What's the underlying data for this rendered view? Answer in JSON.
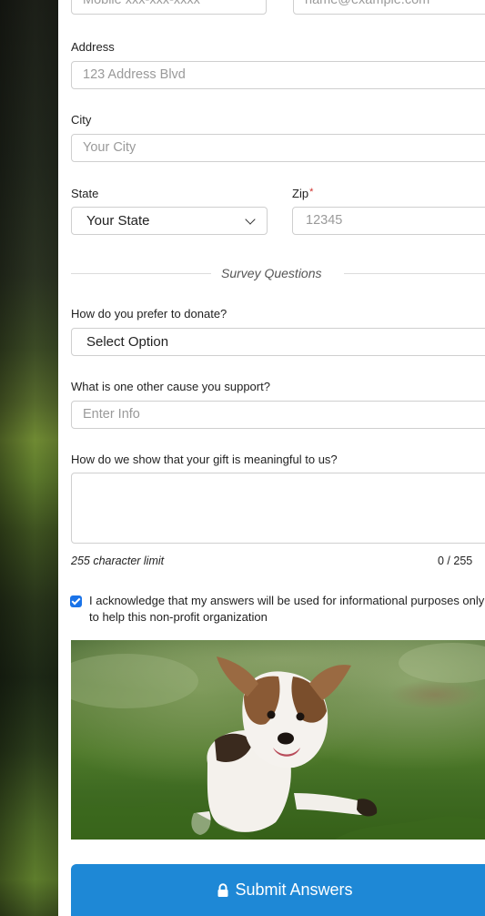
{
  "contact": {
    "phone_placeholder": "Mobile xxx-xxx-xxxx",
    "email_placeholder": "name@example.com"
  },
  "address": {
    "label": "Address",
    "placeholder": "123 Address Blvd"
  },
  "city": {
    "label": "City",
    "placeholder": "Your City"
  },
  "state": {
    "label": "State",
    "value": "Your State"
  },
  "zip": {
    "label": "Zip",
    "required_mark": "*",
    "placeholder": "12345"
  },
  "survey": {
    "heading": "Survey Questions",
    "donate_label": "How do you prefer to donate?",
    "donate_value": "Select Option",
    "cause_label": "What is one other cause you support?",
    "cause_placeholder": "Enter Info",
    "gift_label": "How do we show that your gift is meaningful to us?",
    "char_limit": "255 character limit",
    "char_counter": "0 / 255"
  },
  "acknowledge": {
    "checked": true,
    "text": "I acknowledge that my answers will be used for informational purposes only to help this non-profit organization"
  },
  "submit": {
    "label": "Submit Answers",
    "icon": "lock-icon"
  },
  "colors": {
    "button": "#1e88d6",
    "checkbox": "#1a73e8",
    "required": "#d0312d"
  }
}
